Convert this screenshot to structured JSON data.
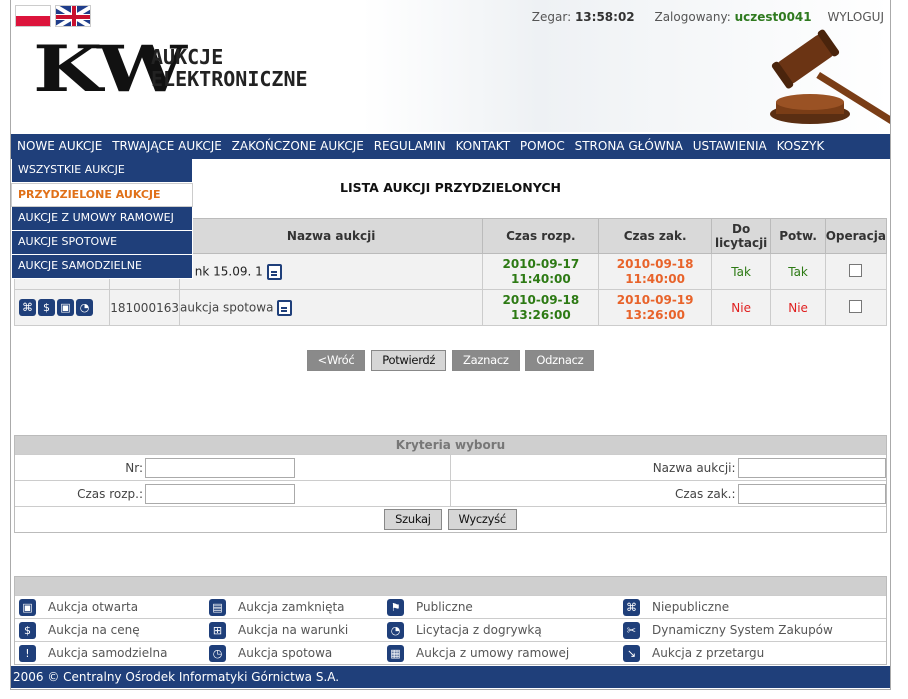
{
  "header": {
    "clock_label": "Zegar:",
    "clock_value": "13:58:02",
    "logged_label": "Zalogowany:",
    "username": "uczest0041",
    "logout": "WYLOGUJ",
    "logo_main": "KW",
    "logo_line1": "AUKCJE",
    "logo_line2": "ELEKTRONICZNE"
  },
  "nav": [
    "NOWE AUKCJE",
    "TRWAJĄCE AUKCJE",
    "ZAKOŃCZONE AUKCJE",
    "REGULAMIN",
    "KONTAKT",
    "POMOC",
    "STRONA GŁÓWNA",
    "USTAWIENIA",
    "KOSZYK"
  ],
  "dropdown": [
    "WSZYSTKIE AUKCJE",
    "PRZYDZIELONE AUKCJE",
    "AUKCJE Z UMOWY RAMOWEJ",
    "AUKCJE SPOTOWE",
    "AUKCJE SAMODZIELNE"
  ],
  "page_title": "LISTA AUKCJI PRZYDZIELONYCH",
  "table": {
    "headers": [
      "Nazwa aukcji",
      "Czas rozp.",
      "Czas zak.",
      "Do licytacji",
      "Potw.",
      "Operacja"
    ],
    "rows": [
      {
        "id": "",
        "name": "st nk 15.09. 1",
        "start_date": "2010-09-17",
        "start_time": "11:40:00",
        "end_date": "2010-09-18",
        "end_time": "11:40:00",
        "do_licytacji": "Tak",
        "potw": "Tak"
      },
      {
        "id": "181000163",
        "name": "aukcja spotowa",
        "start_date": "2010-09-18",
        "start_time": "13:26:00",
        "end_date": "2010-09-19",
        "end_time": "13:26:00",
        "do_licytacji": "Nie",
        "potw": "Nie"
      }
    ]
  },
  "buttons": {
    "back": "<Wróć",
    "confirm": "Potwierdź",
    "select": "Zaznacz",
    "deselect": "Odznacz"
  },
  "criteria": {
    "title": "Kryteria wyboru",
    "nr": "Nr:",
    "name": "Nazwa aukcji:",
    "start": "Czas rozp.:",
    "end": "Czas zak.:",
    "search": "Szukaj",
    "clear": "Wyczyść"
  },
  "legend": [
    [
      "Aukcja otwarta",
      "Aukcja zamknięta",
      "Publiczne",
      "Niepubliczne"
    ],
    [
      "Aukcja na cenę",
      "Aukcja na warunki",
      "Licytacja z dogrywką",
      "Dynamiczny System Zakupów"
    ],
    [
      "Aukcja samodzielna",
      "Aukcja spotowa",
      "Aukcja z umowy ramowej",
      "Aukcja z przetargu"
    ]
  ],
  "footer": "2006 © Centralny Ośrodek Informatyki Górnictwa S.A.",
  "colors": {
    "navy": "#1f3f7a",
    "green": "#2d7a14",
    "orange": "#e8632a",
    "red": "#e02020"
  }
}
